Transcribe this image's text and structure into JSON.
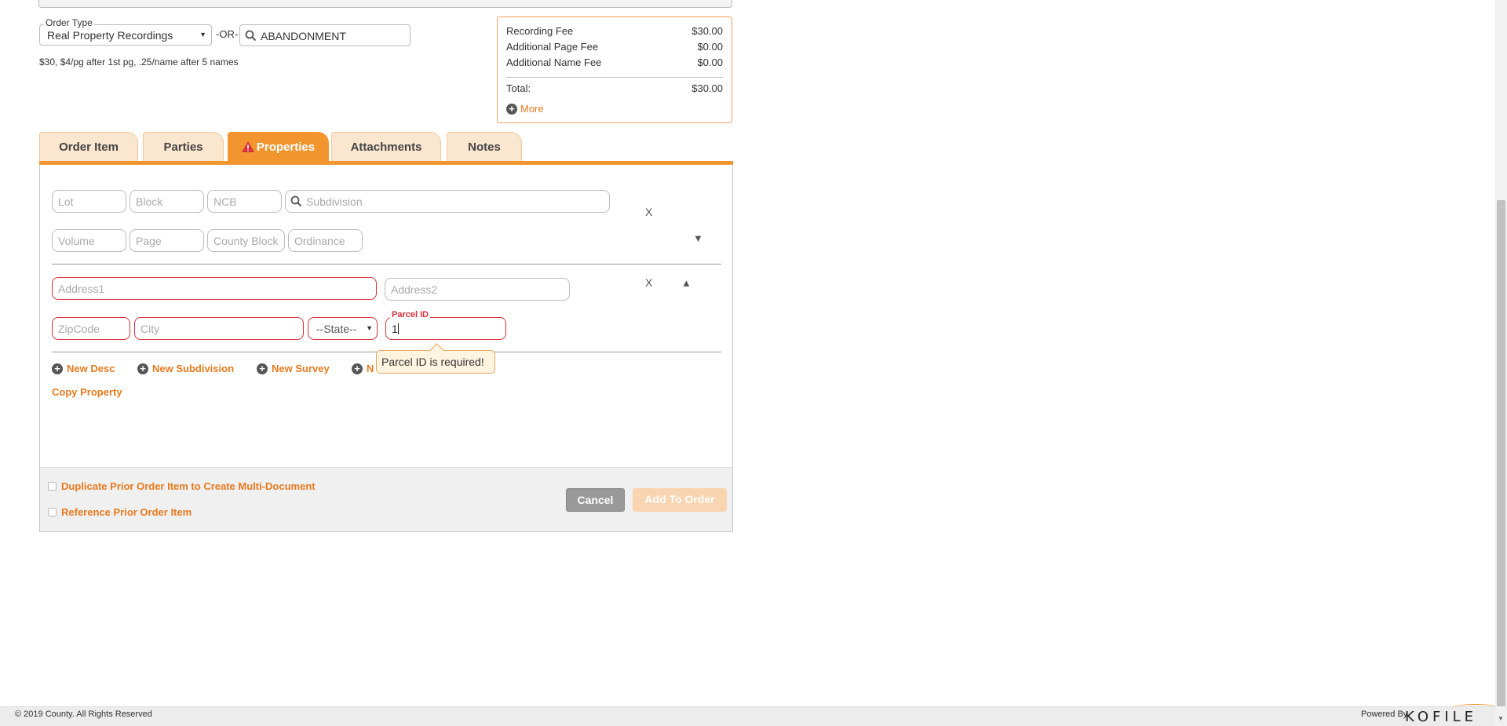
{
  "order": {
    "type_legend": "Order Type",
    "type_value": "Real Property Recordings",
    "or_label": "-OR-",
    "search_value": "ABANDONMENT",
    "fee_note": "$30, $4/pg after 1st pg, .25/name after 5 names"
  },
  "fees": {
    "recording_label": "Recording Fee",
    "recording_value": "$30.00",
    "page_label": "Additional Page Fee",
    "page_value": "$0.00",
    "name_label": "Additional Name Fee",
    "name_value": "$0.00",
    "total_label": "Total:",
    "total_value": "$30.00",
    "more_label": "More"
  },
  "tabs": [
    {
      "label": "Order Item"
    },
    {
      "label": "Parties"
    },
    {
      "label": "Properties"
    },
    {
      "label": "Attachments"
    },
    {
      "label": "Notes"
    }
  ],
  "active_tab": "Properties",
  "property_legal": {
    "lot_placeholder": "Lot",
    "block_placeholder": "Block",
    "ncb_placeholder": "NCB",
    "subdivision_placeholder": "Subdivision",
    "volume_placeholder": "Volume",
    "page_placeholder": "Page",
    "county_block_placeholder": "County Block",
    "ordinance_placeholder": "Ordinance",
    "remove_label": "X"
  },
  "property_address": {
    "address1_placeholder": "Address1",
    "address2_placeholder": "Address2",
    "zip_placeholder": "ZipCode",
    "city_placeholder": "City",
    "state_value": "--State--",
    "parcel_legend": "Parcel ID",
    "parcel_value": "1",
    "remove_label": "X",
    "error_tooltip": "Parcel ID is required!"
  },
  "links": {
    "new_desc": "New Desc",
    "new_subdivision": "New Subdivision",
    "new_survey": "New Survey",
    "new_other": "N",
    "copy_property": "Copy Property"
  },
  "panel_footer": {
    "duplicate_label": "Duplicate Prior Order Item to Create Multi-Document",
    "reference_label": "Reference Prior Order Item",
    "cancel_label": "Cancel",
    "add_label": "Add To Order"
  },
  "footer": {
    "copyright": "© 2019 County. All Rights Reserved",
    "powered_by": "Powered By",
    "brand": "KOFILE"
  },
  "colors": {
    "accent": "#f2952f",
    "link": "#e87a1e",
    "error": "#d9303a"
  }
}
